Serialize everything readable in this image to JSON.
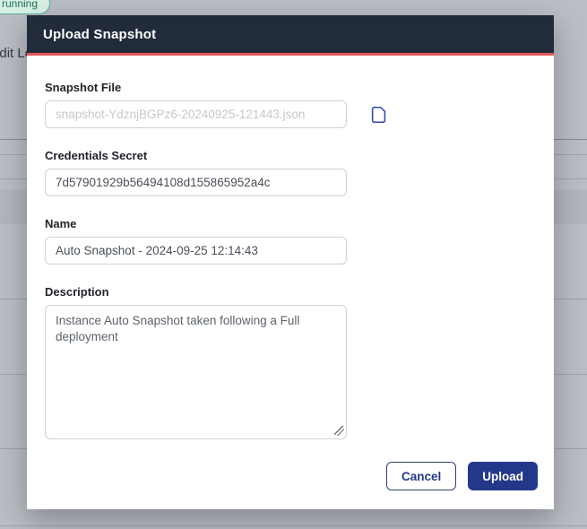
{
  "background": {
    "badge": "running",
    "partial_text": "Audit Log"
  },
  "modal": {
    "title": "Upload Snapshot",
    "fields": {
      "snapshot_file": {
        "label": "Snapshot File",
        "placeholder": "snapshot-YdznjBGPz6-20240925-121443.json"
      },
      "credentials_secret": {
        "label": "Credentials Secret",
        "value": "7d57901929b56494108d155865952a4c"
      },
      "name": {
        "label": "Name",
        "value": "Auto Snapshot - 2024-09-25 12:14:43"
      },
      "description": {
        "label": "Description",
        "value": "Instance Auto Snapshot taken following a Full deployment"
      }
    },
    "icons": {
      "file_icon": "file-icon"
    },
    "buttons": {
      "cancel": "Cancel",
      "upload": "Upload"
    }
  },
  "colors": {
    "header_bg": "#212b3a",
    "accent_red": "#e4555c",
    "primary_blue": "#24388a",
    "badge_green_border": "#55b098",
    "badge_green_bg": "#d9f1e5",
    "badge_green_text": "#1c6e59",
    "page_dim_gray": "#b9bdc4",
    "input_border": "#ced3d9",
    "file_icon_blue": "#2e4ba3"
  }
}
